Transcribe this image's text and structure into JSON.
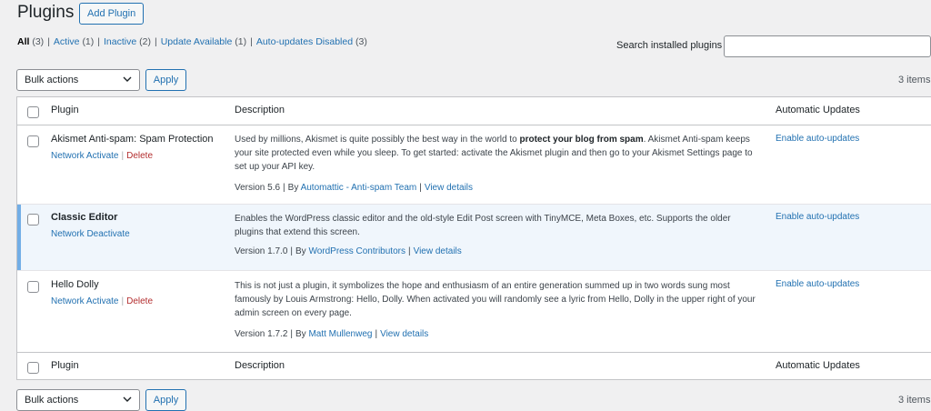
{
  "header": {
    "title": "Plugins",
    "add_new": "Add Plugin"
  },
  "filters": [
    {
      "label": "All",
      "count": "(3)"
    },
    {
      "label": "Active",
      "count": "(1)"
    },
    {
      "label": "Inactive",
      "count": "(2)"
    },
    {
      "label": "Update Available",
      "count": "(1)"
    },
    {
      "label": "Auto-updates Disabled",
      "count": "(3)"
    }
  ],
  "search": {
    "label": "Search installed plugins",
    "value": ""
  },
  "bulk": {
    "top_label": "Bulk actions",
    "bottom_label": "Bulk actions",
    "apply": "Apply",
    "items": "3 items"
  },
  "columns": {
    "plugin": "Plugin",
    "description": "Description",
    "auto": "Automatic Updates"
  },
  "plugins": [
    {
      "name": "Akismet Anti-spam: Spam Protection",
      "action1": "Network Activate",
      "action2": "Delete",
      "desc_a": "Used by millions, Akismet is quite possibly the best way in the world to ",
      "desc_b": "protect your blog from spam",
      "desc_c": ". Akismet Anti-spam keeps your site protected even while you sleep. To get started: activate the Akismet plugin and then go to your Akismet Settings page to set up your API key.",
      "version": "Version 5.6",
      "by": "By",
      "author": "Automattic - Anti-spam Team",
      "details": "View details",
      "auto": "Enable auto-updates"
    },
    {
      "name": "Classic Editor",
      "action1": "Network Deactivate",
      "desc": "Enables the WordPress classic editor and the old-style Edit Post screen with TinyMCE, Meta Boxes, etc. Supports the older plugins that extend this screen.",
      "version": "Version 1.7.0",
      "by": "By",
      "author": "WordPress Contributors",
      "details": "View details",
      "auto": "Enable auto-updates"
    },
    {
      "name": "Hello Dolly",
      "action1": "Network Activate",
      "action2": "Delete",
      "desc": "This is not just a plugin, it symbolizes the hope and enthusiasm of an entire generation summed up in two words sung most famously by Louis Armstrong: Hello, Dolly. When activated you will randomly see a lyric from Hello, Dolly in the upper right of your admin screen on every page.",
      "version": "Version 1.7.2",
      "by": "By",
      "author": "Matt Mullenweg",
      "details": "View details",
      "auto": "Enable auto-updates"
    }
  ]
}
